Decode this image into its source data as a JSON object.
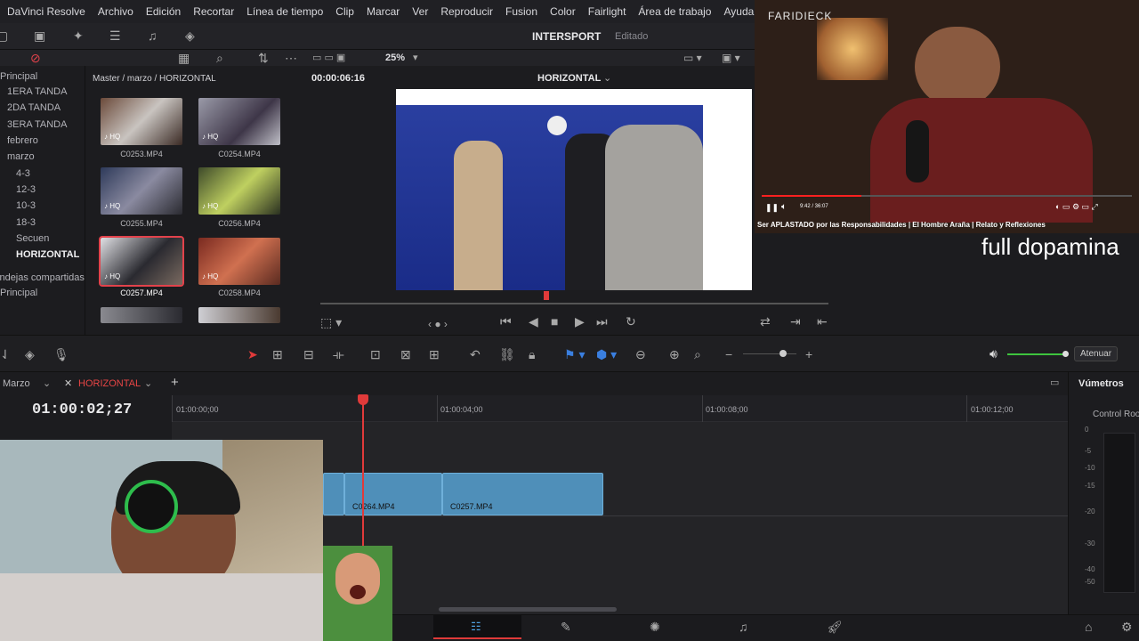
{
  "menu": {
    "items": [
      "DaVinci Resolve",
      "Archivo",
      "Edición",
      "Recortar",
      "Línea de tiempo",
      "Clip",
      "Marcar",
      "Ver",
      "Reproducir",
      "Fusion",
      "Color",
      "Fairlight",
      "Área de trabajo",
      "Ayuda"
    ]
  },
  "project": {
    "title": "INTERSPORT",
    "status": "Editado"
  },
  "viewer": {
    "zoom": "25%",
    "timecode": "00:00:06:16",
    "timeline_name": "HORIZONTAL"
  },
  "mediapool": {
    "path": "Master / marzo / HORIZONTAL",
    "bins": [
      "Principal",
      "1ERA TANDA",
      "2DA TANDA",
      "3ERA TANDA",
      "febrero",
      "marzo",
      "4-3",
      "12-3",
      "10-3",
      "18-3",
      "Secuen",
      "HORIZONTAL",
      "Bandejas compartidas",
      "Principal"
    ],
    "selected_bin": "HORIZONTAL",
    "clips": [
      "C0253.MP4",
      "C0254.MP4",
      "C0255.MP4",
      "C0256.MP4",
      "C0257.MP4",
      "C0258.MP4"
    ],
    "selected_clip": "C0257.MP4",
    "badge": "HQ"
  },
  "youtube": {
    "channel_watermark": "FARIDIECK",
    "time": "9:42 / 36:07",
    "caption": "Ser APLASTADO por las Responsabilidades | El Hombre Araña | Relato y Reflexiones",
    "progress": 0.27
  },
  "overlay_text": "full dopamina",
  "timeline": {
    "tabs": [
      "Marzo",
      "HORIZONTAL"
    ],
    "active_tab": "HORIZONTAL",
    "timecode": "01:00:02;27",
    "ruler": [
      "01:00:00;00",
      "01:00:04;00",
      "01:00:08;00",
      "01:00:12;00"
    ],
    "clips": [
      "C0264.MP4",
      "C0257.MP4"
    ],
    "audio_label": "Atenuar"
  },
  "meters": {
    "title": "Vúmetros",
    "subtitle": "Control Room",
    "scale": [
      "0",
      "-5",
      "-10",
      "-15",
      "-20",
      "-30",
      "-40",
      "-50"
    ]
  },
  "colors": {
    "accent_red": "#e03a3a",
    "clip_blue": "#4f8fb9",
    "volume_green": "#3ec43e"
  }
}
